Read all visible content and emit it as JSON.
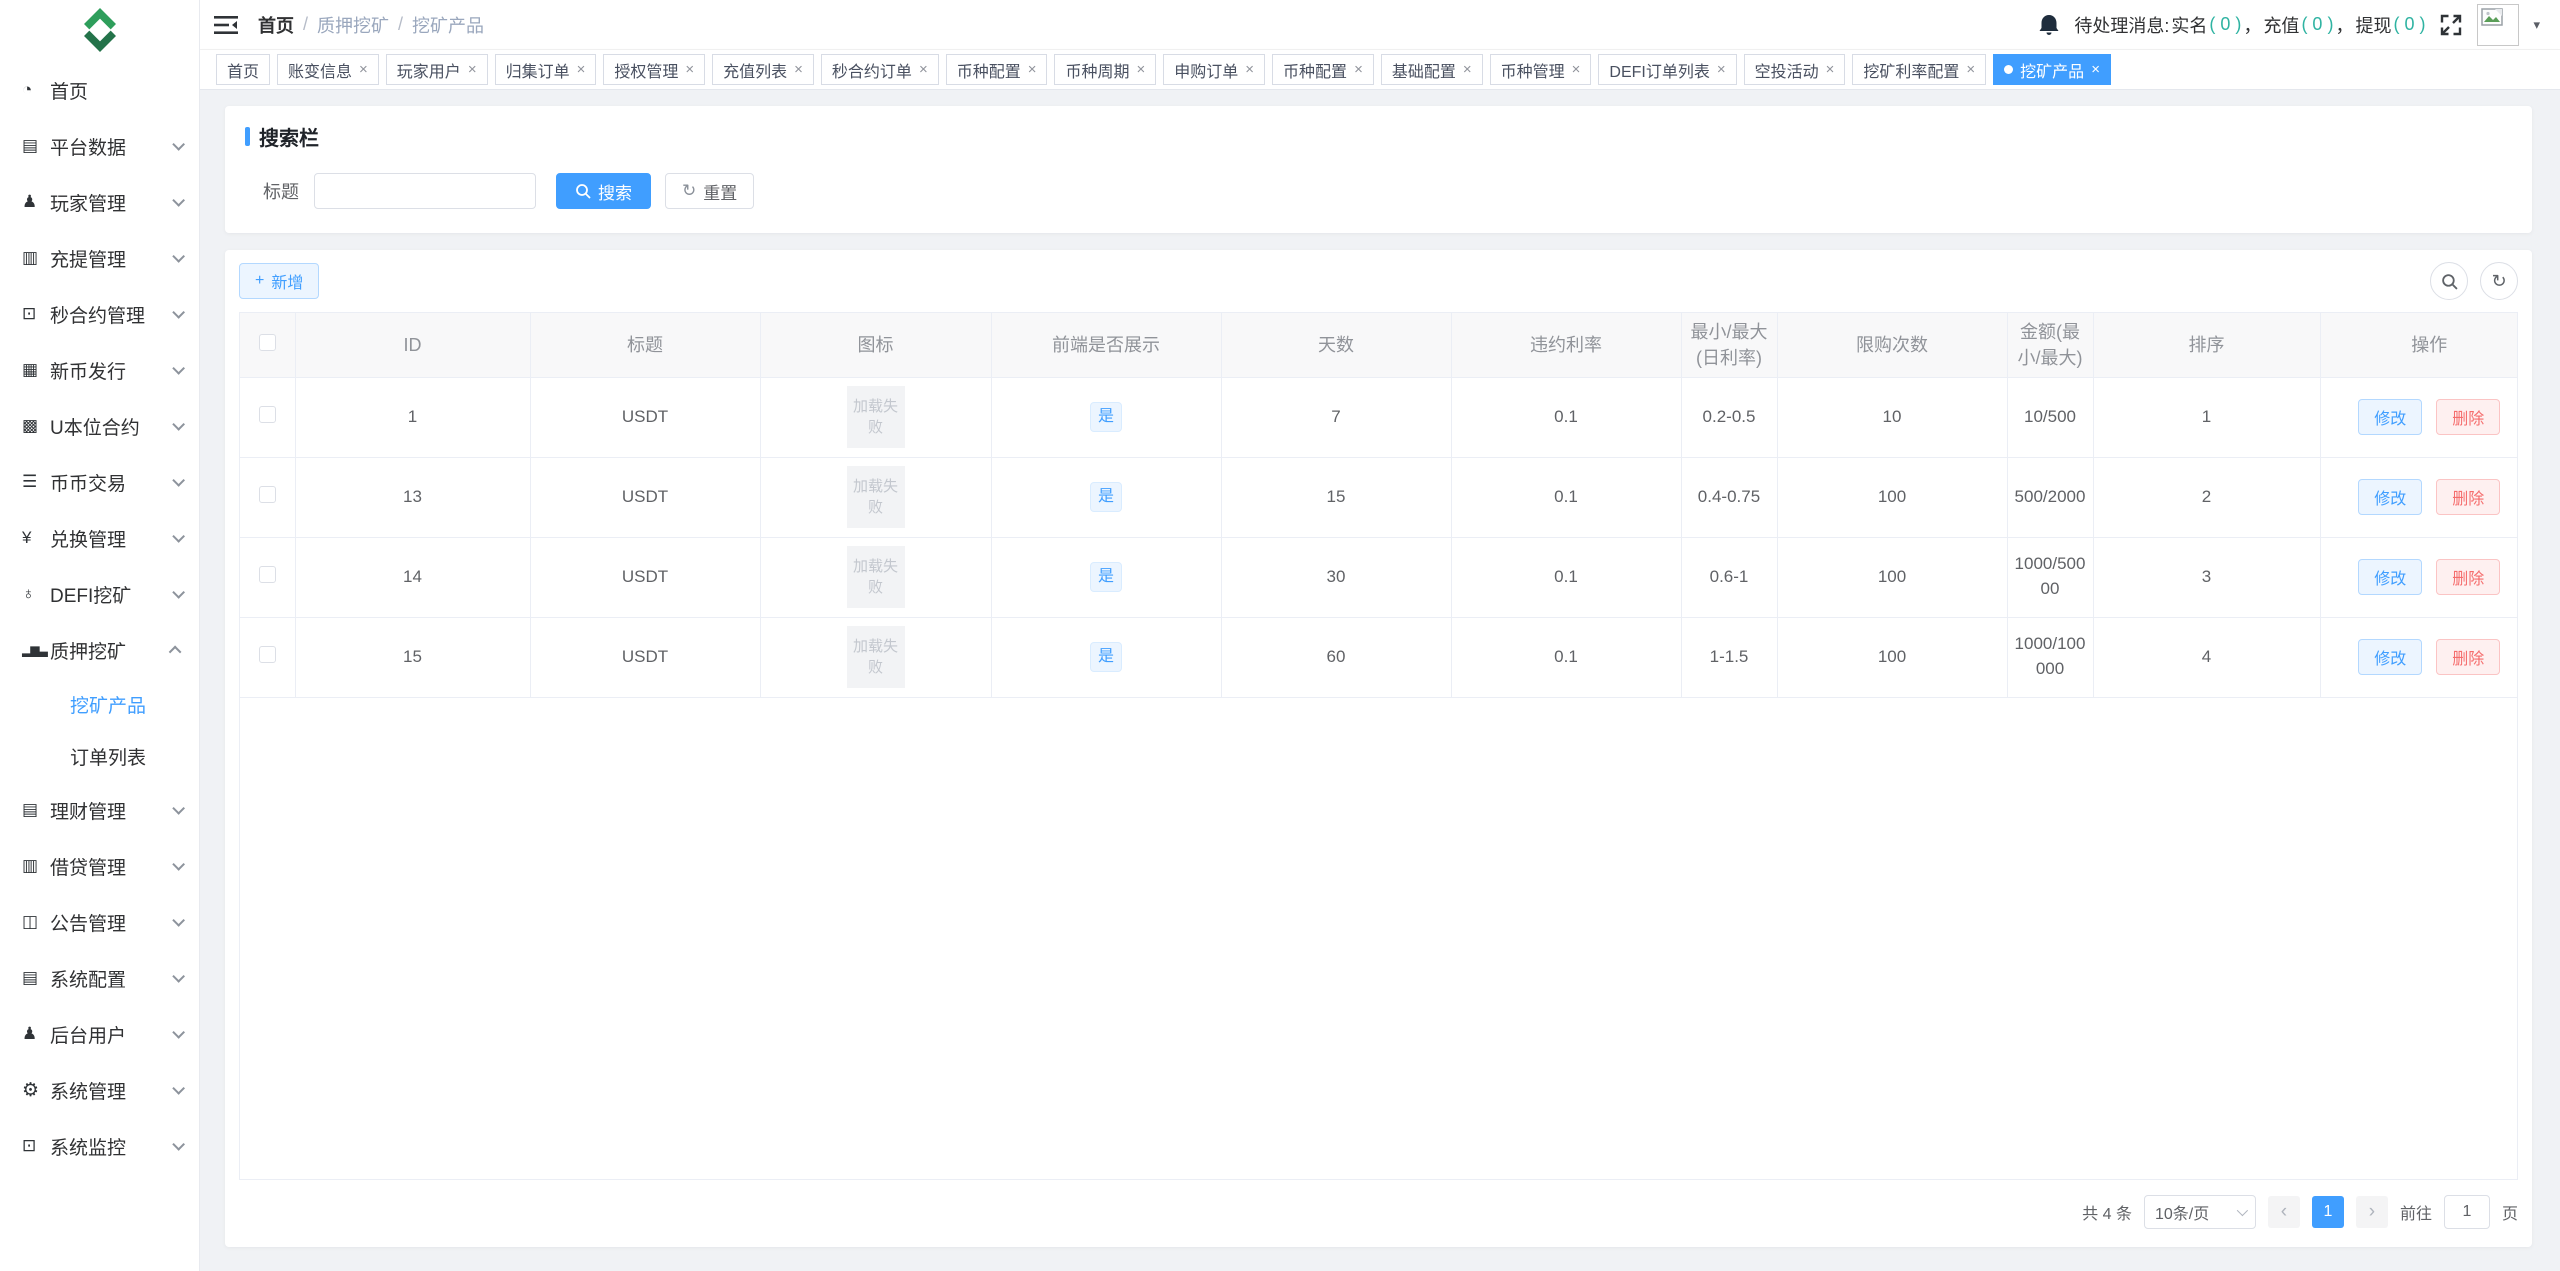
{
  "colors": {
    "primary": "#409eff",
    "danger": "#f56c6c",
    "count_teal": "#2fb3a2"
  },
  "sidebar": {
    "items": [
      {
        "name": "home",
        "icon": "dashboard-icon",
        "glyph": "◔",
        "label": "首页",
        "arrow": false
      },
      {
        "name": "platform-data",
        "icon": "data-sheet-icon",
        "glyph": "▤",
        "label": "平台数据",
        "arrow": true
      },
      {
        "name": "player-management",
        "icon": "user-icon",
        "glyph": "♟",
        "label": "玩家管理",
        "arrow": true
      },
      {
        "name": "deposit-withdraw-management",
        "icon": "copy-document-icon",
        "glyph": "▥",
        "label": "充提管理",
        "arrow": true
      },
      {
        "name": "seconds-contract-management",
        "icon": "monitor-icon",
        "glyph": "⊡",
        "label": "秒合约管理",
        "arrow": true
      },
      {
        "name": "new-coin-issue",
        "icon": "calendar-icon",
        "glyph": "▦",
        "label": "新币发行",
        "arrow": true
      },
      {
        "name": "u-margin-contract",
        "icon": "grid-icon",
        "glyph": "▩",
        "label": "U本位合约",
        "arrow": true
      },
      {
        "name": "coin-coin-trade",
        "icon": "list-icon",
        "glyph": "☰",
        "label": "币币交易",
        "arrow": true
      },
      {
        "name": "exchange-management",
        "icon": "yen-icon",
        "glyph": "¥",
        "label": "兑换管理",
        "arrow": true
      },
      {
        "name": "defi-mining",
        "icon": "pointer-icon",
        "glyph": "♁",
        "label": "DEFI挖矿",
        "arrow": true
      },
      {
        "name": "staking-mining",
        "icon": "bar-chart-icon",
        "glyph": "▂▆▃",
        "label": "质押挖矿",
        "arrow": true,
        "expanded": true,
        "children": [
          {
            "name": "mining-products",
            "label": "挖矿产品",
            "active": true
          },
          {
            "name": "order-list",
            "label": "订单列表",
            "active": false
          }
        ]
      },
      {
        "name": "finance-management",
        "icon": "document-icon",
        "glyph": "▤",
        "label": "理财管理",
        "arrow": true
      },
      {
        "name": "lending-management",
        "icon": "data-sheet-icon",
        "glyph": "▥",
        "label": "借贷管理",
        "arrow": true
      },
      {
        "name": "notice-management",
        "icon": "book-icon",
        "glyph": "◫",
        "label": "公告管理",
        "arrow": true
      },
      {
        "name": "system-config",
        "icon": "document-icon",
        "glyph": "▤",
        "label": "系统配置",
        "arrow": true
      },
      {
        "name": "backend-users",
        "icon": "users-icon",
        "glyph": "♟",
        "label": "后台用户",
        "arrow": true
      },
      {
        "name": "system-management",
        "icon": "gear-icon",
        "glyph": "⚙",
        "label": "系统管理",
        "arrow": true
      },
      {
        "name": "system-monitor",
        "icon": "monitor-icon",
        "glyph": "⊡",
        "label": "系统监控",
        "arrow": true
      }
    ]
  },
  "header": {
    "breadcrumb": [
      {
        "label": "首页",
        "muted": false
      },
      {
        "label": "质押挖矿",
        "muted": true
      },
      {
        "label": "挖矿产品",
        "muted": true
      }
    ],
    "separator": "/",
    "notice": {
      "prefix": "待处理消息: ",
      "separator": "，",
      "groups": [
        {
          "label": "实名",
          "count_display": "( 0 )"
        },
        {
          "label": "充值",
          "count_display": "( 0 )"
        },
        {
          "label": "提现",
          "count_display": "( 0 )"
        }
      ]
    }
  },
  "tabs": [
    {
      "label": "首页",
      "closable": false,
      "active": false
    },
    {
      "label": "账变信息",
      "closable": true,
      "active": false
    },
    {
      "label": "玩家用户",
      "closable": true,
      "active": false
    },
    {
      "label": "归集订单",
      "closable": true,
      "active": false
    },
    {
      "label": "授权管理",
      "closable": true,
      "active": false
    },
    {
      "label": "充值列表",
      "closable": true,
      "active": false
    },
    {
      "label": "秒合约订单",
      "closable": true,
      "active": false
    },
    {
      "label": "币种配置",
      "closable": true,
      "active": false
    },
    {
      "label": "币种周期",
      "closable": true,
      "active": false
    },
    {
      "label": "申购订单",
      "closable": true,
      "active": false
    },
    {
      "label": "币种配置",
      "closable": true,
      "active": false
    },
    {
      "label": "基础配置",
      "closable": true,
      "active": false
    },
    {
      "label": "币种管理",
      "closable": true,
      "active": false
    },
    {
      "label": "DEFI订单列表",
      "closable": true,
      "active": false
    },
    {
      "label": "空投活动",
      "closable": true,
      "active": false
    },
    {
      "label": "挖矿利率配置",
      "closable": true,
      "active": false
    },
    {
      "label": "挖矿产品",
      "closable": true,
      "active": true
    }
  ],
  "search": {
    "title": "搜索栏",
    "field_label": "标题",
    "input_value": "",
    "search_label": "搜索",
    "reset_label": "重置",
    "reset_icon": "↻"
  },
  "table": {
    "add_label": "新增",
    "add_plus": "+",
    "edit_label": "修改",
    "delete_label": "删除",
    "refresh_icon": "↻",
    "columns": [
      {
        "key": "select",
        "label": ""
      },
      {
        "key": "id",
        "label": "ID"
      },
      {
        "key": "title",
        "label": "标题"
      },
      {
        "key": "icon",
        "label": "图标"
      },
      {
        "key": "show",
        "label": "前端是否展示"
      },
      {
        "key": "days",
        "label": "天数"
      },
      {
        "key": "default_rate",
        "label": "违约利率"
      },
      {
        "key": "rate_range",
        "label": "最小/最大(日利率)"
      },
      {
        "key": "limit",
        "label": "限购次数"
      },
      {
        "key": "amount",
        "label": "金额(最小/最大)"
      },
      {
        "key": "sort",
        "label": "排序"
      },
      {
        "key": "actions",
        "label": "操作"
      }
    ],
    "rows": [
      {
        "id": "1",
        "title": "USDT",
        "icon_text": "加载失败",
        "show": "是",
        "days": "7",
        "default_rate": "0.1",
        "rate_range": "0.2-0.5",
        "limit": "10",
        "amount": "10/500",
        "sort": "1"
      },
      {
        "id": "13",
        "title": "USDT",
        "icon_text": "加载失败",
        "show": "是",
        "days": "15",
        "default_rate": "0.1",
        "rate_range": "0.4-0.75",
        "limit": "100",
        "amount": "500/2000",
        "sort": "2"
      },
      {
        "id": "14",
        "title": "USDT",
        "icon_text": "加载失败",
        "show": "是",
        "days": "30",
        "default_rate": "0.1",
        "rate_range": "0.6-1",
        "limit": "100",
        "amount": "1000/50000",
        "sort": "3"
      },
      {
        "id": "15",
        "title": "USDT",
        "icon_text": "加载失败",
        "show": "是",
        "days": "60",
        "default_rate": "0.1",
        "rate_range": "1-1.5",
        "limit": "100",
        "amount": "1000/100000",
        "sort": "4"
      }
    ]
  },
  "pagination": {
    "total": "共 4 条",
    "page_size": "10条/页",
    "prev": "‹",
    "next": "›",
    "current": "1",
    "goto_prefix": "前往",
    "goto_value": "1",
    "goto_suffix": "页"
  }
}
